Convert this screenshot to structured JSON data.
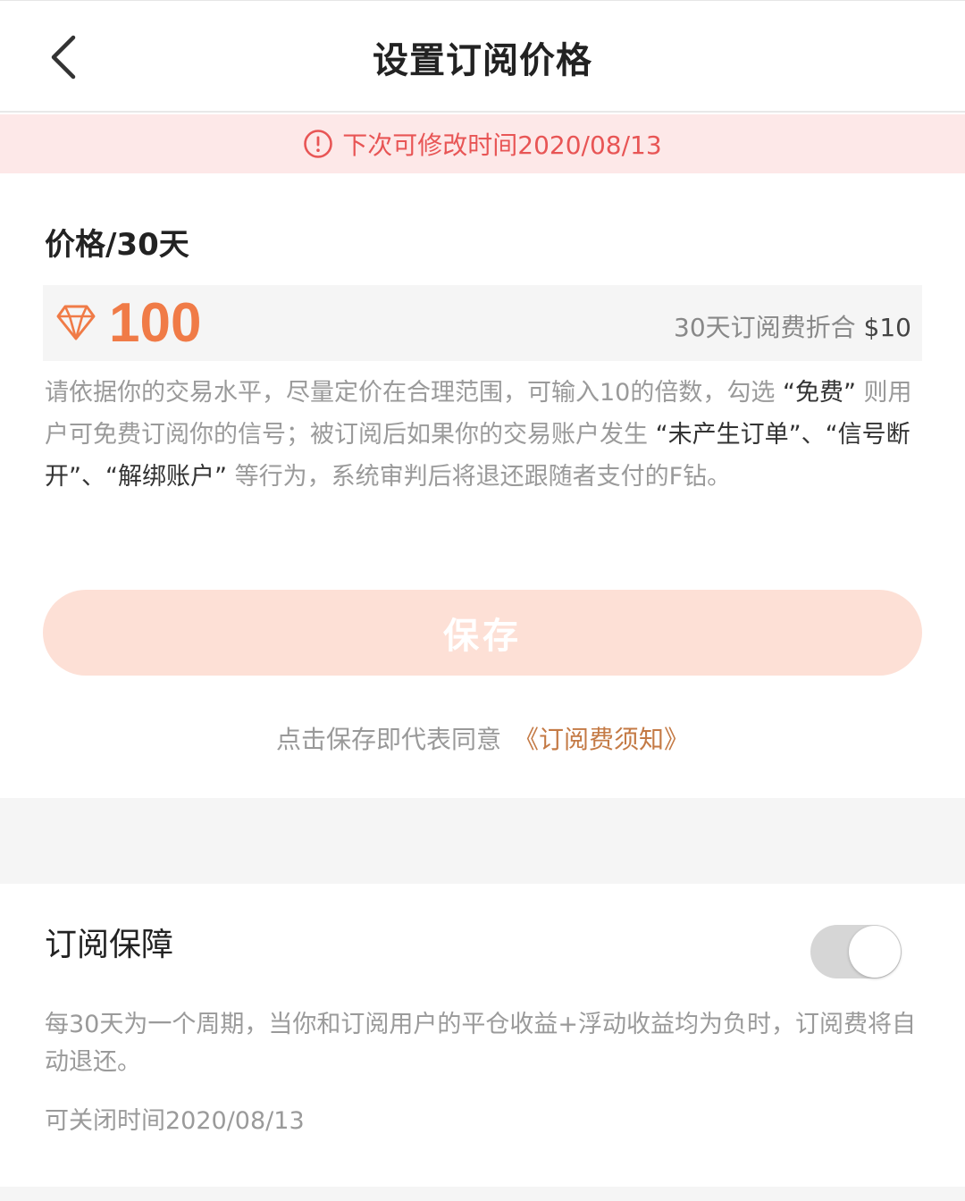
{
  "header": {
    "title": "设置订阅价格",
    "back_icon": "chevron-left-icon"
  },
  "notice": {
    "icon": "alert-circle-icon",
    "text": "下次可修改时间2020/08/13",
    "color": "#e85555"
  },
  "price": {
    "label": "价格/30天",
    "icon": "diamond-icon",
    "value": "100",
    "convert_prefix": "30天订阅费折合 ",
    "convert_amount": "$10",
    "accent_color": "#f07b47"
  },
  "description": {
    "part1": "请依据你的交易水平，尽量定价在合理范围，可输入10的倍数，勾选 ",
    "free": "“免费”",
    "part2": " 则用户可免费订阅你的信号；被订阅后如果你的交易账户发生 ",
    "no_orders": "“未产生订单”",
    "sep1": "、",
    "disconnected": "“信号断开”",
    "sep2": "、",
    "unbind": "“解绑账户”",
    "part3": " 等行为，系统审判后将退还跟随者支付的F钻。"
  },
  "save_button": {
    "label": "保存"
  },
  "agreement": {
    "text": "点击保存即代表同意",
    "link": "《订阅费须知》"
  },
  "guarantee": {
    "title": "订阅保障",
    "toggle_on": false,
    "description": "每30天为一个周期，当你和订阅用户的平仓收益+浮动收益均为负时，订阅费将自动退还。",
    "close_time": "可关闭时间2020/08/13"
  }
}
